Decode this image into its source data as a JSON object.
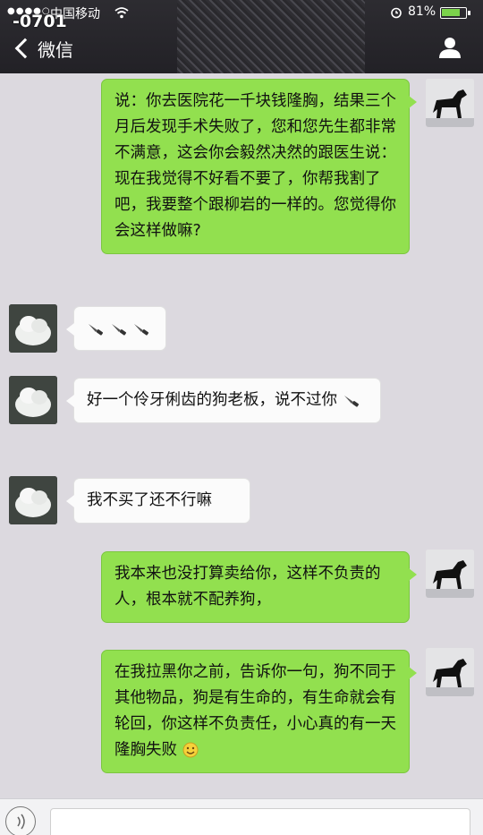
{
  "status_bar": {
    "signal": "●●●●○",
    "carrier": "中国移动",
    "watermark": "-0701",
    "battery_pct": "81%",
    "battery_level": 0.81
  },
  "nav": {
    "back_label": "微信"
  },
  "messages": [
    {
      "side": "right",
      "text": "说：你去医院花一千块钱隆胸，结果三个月后发现手术失败了，您和您先生都非常不满意，这会你会毅然决然的跟医生说：现在我觉得不好看不要了，你帮我割了吧，我要整个跟柳岩的一样的。您觉得你会这样做嘛?"
    },
    {
      "side": "left",
      "text": ""
    },
    {
      "side": "left",
      "text": "好一个伶牙俐齿的狗老板，说不过你"
    },
    {
      "side": "left",
      "text": "我不买了还不行嘛"
    },
    {
      "side": "right",
      "text": "我本来也没打算卖给你，这样不负责的人，根本就不配养狗，"
    },
    {
      "side": "right",
      "text": "在我拉黑你之前，告诉你一句，狗不同于其他物品，狗是有生命的，有生命就会有轮回，你这样不负责任，小心真的有一天隆胸失败"
    }
  ],
  "colors": {
    "me_bubble": "#92e04f",
    "other_bubble": "#fbfbfb",
    "nav_bg": "#2d2c31",
    "chat_bg": "#dcd9df"
  },
  "icons": {
    "knife": "knife-emoji-icon",
    "smile": "smile-emoji-icon",
    "person": "person-icon",
    "back": "chevron-left-icon"
  }
}
